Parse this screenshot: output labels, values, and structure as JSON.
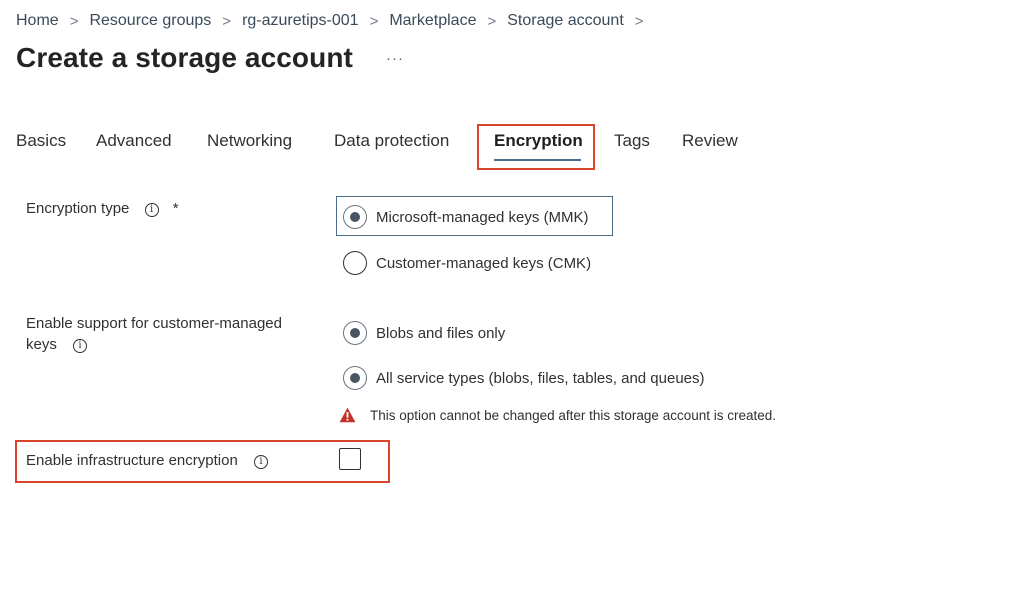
{
  "breadcrumb": {
    "items": [
      "Home",
      "Resource groups",
      "rg-azuretips-001",
      "Marketplace",
      "Storage account"
    ],
    "separator": ">"
  },
  "page": {
    "title": "Create a storage account",
    "more_label": "···"
  },
  "tabs": [
    {
      "label": "Basics",
      "active": false
    },
    {
      "label": "Advanced",
      "active": false
    },
    {
      "label": "Networking",
      "active": false
    },
    {
      "label": "Data protection",
      "active": false
    },
    {
      "label": "Encryption",
      "active": true
    },
    {
      "label": "Tags",
      "active": false
    },
    {
      "label": "Review",
      "active": false
    }
  ],
  "encryption_type": {
    "label": "Encryption type",
    "required_marker": "*",
    "info_glyph": "i",
    "options": [
      {
        "label": "Microsoft-managed keys (MMK)",
        "selected": true
      },
      {
        "label": "Customer-managed keys (CMK)",
        "selected": false
      }
    ]
  },
  "cmk_support": {
    "label_line1": "Enable support for customer-managed",
    "label_line2": "keys",
    "info_glyph": "i",
    "options": [
      {
        "label": "Blobs and files only",
        "selected": true
      },
      {
        "label": "All service types (blobs, files, tables, and queues)",
        "selected": true
      }
    ],
    "warning": "This option cannot be changed after this storage account is created."
  },
  "infrastructure_encryption": {
    "label": "Enable infrastructure encryption",
    "info_glyph": "i",
    "checked": false
  },
  "colors": {
    "highlight": "#d9452b",
    "accent": "#4a6b8a",
    "warning": "#c4312b"
  },
  "icons": {
    "info": "info-circle-icon",
    "warning": "warning-triangle-icon",
    "separator": "chevron-right"
  }
}
